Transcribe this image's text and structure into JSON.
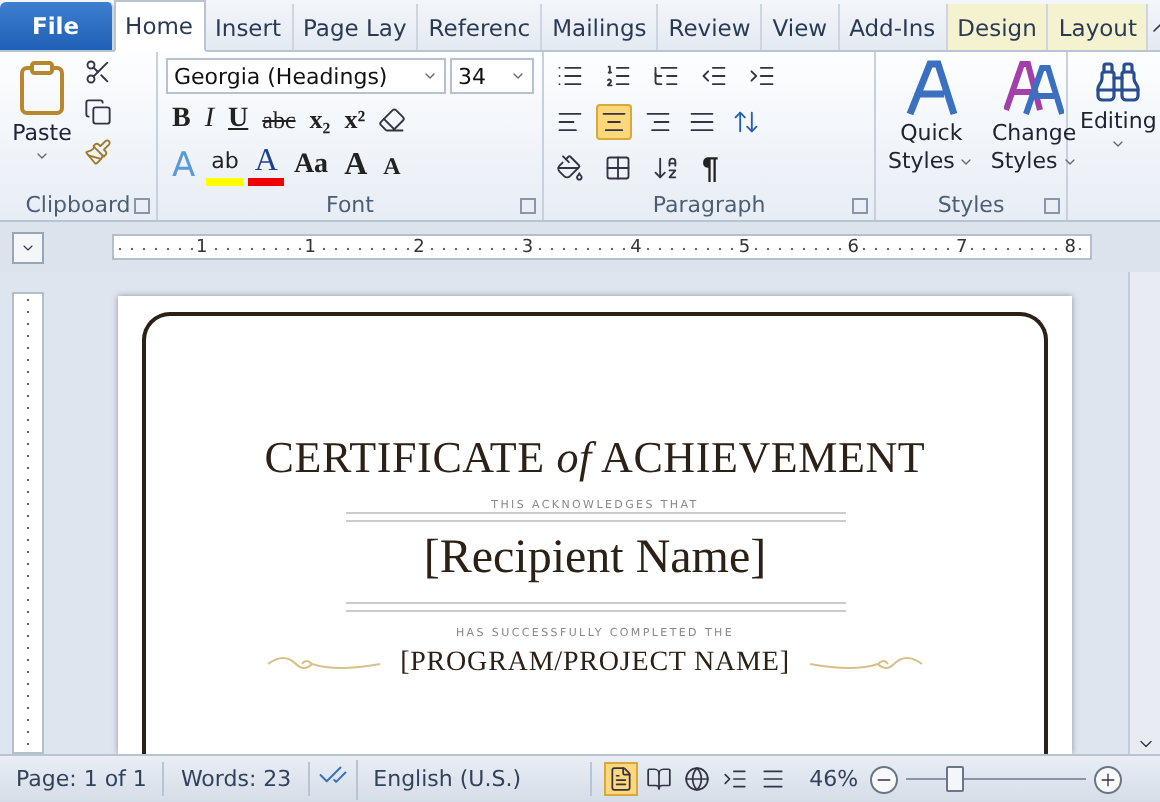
{
  "tabs": [
    {
      "label": "File",
      "kind": "file",
      "selected": false
    },
    {
      "label": "Home",
      "kind": "normal",
      "selected": true
    },
    {
      "label": "Insert",
      "kind": "normal",
      "selected": false
    },
    {
      "label": "Page Lay",
      "kind": "normal",
      "selected": false
    },
    {
      "label": "Referenc",
      "kind": "normal",
      "selected": false
    },
    {
      "label": "Mailings",
      "kind": "normal",
      "selected": false
    },
    {
      "label": "Review",
      "kind": "normal",
      "selected": false
    },
    {
      "label": "View",
      "kind": "normal",
      "selected": false
    },
    {
      "label": "Add-Ins",
      "kind": "normal",
      "selected": false
    },
    {
      "label": "Design",
      "kind": "contextual",
      "selected": false
    },
    {
      "label": "Layout",
      "kind": "contextual",
      "selected": false
    }
  ],
  "ribbon": {
    "clipboard": {
      "paste": "Paste",
      "label": "Clipboard"
    },
    "font": {
      "name": "Georgia (Headings)",
      "size": "34",
      "label": "Font",
      "format_buttons": [
        {
          "kind": "bold",
          "label": "B"
        },
        {
          "kind": "italic",
          "label": "I"
        },
        {
          "kind": "underline",
          "label": "U"
        },
        {
          "kind": "strike",
          "label": "abc"
        },
        {
          "kind": "sub",
          "label": "x₂"
        },
        {
          "kind": "sup",
          "label": "x²"
        }
      ],
      "style_buttons": [
        {
          "kind": "effect",
          "label": "A"
        },
        {
          "kind": "highlight",
          "label": "ab"
        },
        {
          "kind": "color",
          "label": "A"
        },
        {
          "kind": "case",
          "label": "Aa"
        },
        {
          "kind": "grow",
          "label": "A"
        },
        {
          "kind": "shrink",
          "label": "A"
        }
      ]
    },
    "paragraph": {
      "label": "Paragraph",
      "pilcrow": "¶",
      "alignment": [
        {
          "kind": "left",
          "selected": false
        },
        {
          "kind": "center",
          "selected": true
        },
        {
          "kind": "right",
          "selected": false
        },
        {
          "kind": "justify",
          "selected": false
        }
      ]
    },
    "styles": {
      "label": "Styles",
      "quick": [
        "Quick",
        "Styles"
      ],
      "change": [
        "Change",
        "Styles"
      ]
    },
    "editing": {
      "label": "Editing"
    }
  },
  "ruler": {
    "numbers": [
      "1",
      "1",
      "2",
      "3",
      "4",
      "5",
      "6",
      "7",
      "8"
    ]
  },
  "document": {
    "title": "CERTIFICATE *of* ACHIEVEMENT",
    "intro": "THIS ACKNOWLEDGES THAT",
    "recipient": "[Recipient Name]",
    "completed": "HAS SUCCESSFULLY COMPLETED THE",
    "program": "[PROGRAM/PROJECT NAME]"
  },
  "status_bar": {
    "page": "Page: 1 of 1",
    "words": "Words: 23",
    "language": "English (U.S.)",
    "zoom": "46%",
    "zoom_level": {
      "level": 0.27
    },
    "views": [
      {
        "kind": "print",
        "selected": true
      },
      {
        "kind": "reading",
        "selected": false
      },
      {
        "kind": "web",
        "selected": false
      },
      {
        "kind": "outline",
        "selected": false
      },
      {
        "kind": "draft",
        "selected": false
      }
    ]
  }
}
